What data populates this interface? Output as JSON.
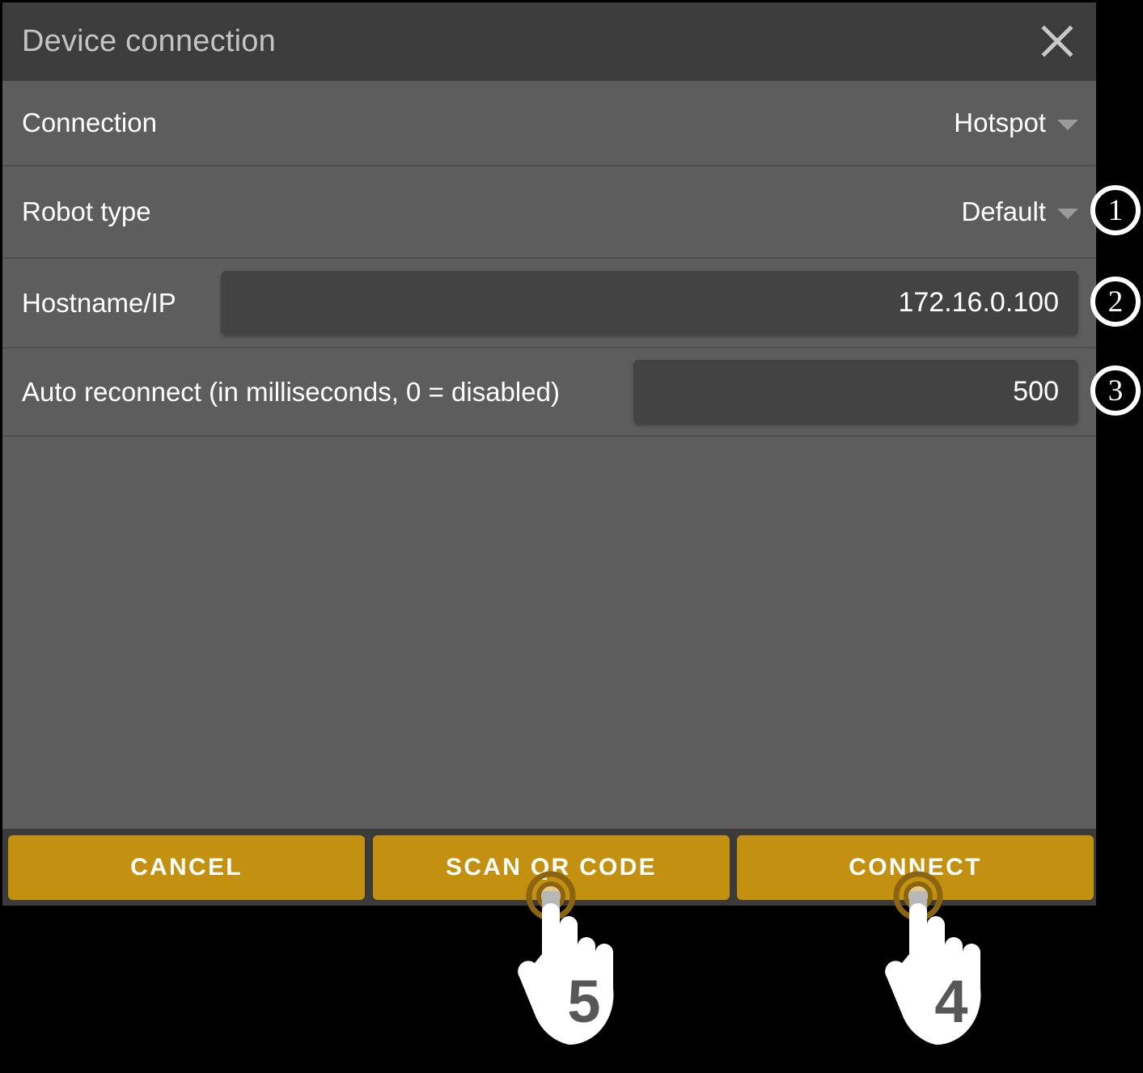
{
  "dialog": {
    "title": "Device connection",
    "close_icon": "close-icon"
  },
  "rows": {
    "connection": {
      "label": "Connection",
      "value": "Hotspot",
      "control": "dropdown"
    },
    "robot_type": {
      "label": "Robot type",
      "value": "Default",
      "control": "dropdown"
    },
    "hostname": {
      "label": "Hostname/IP",
      "value": "172.16.0.100",
      "control": "text-field"
    },
    "auto_reconnect": {
      "label": "Auto reconnect (in milliseconds, 0 = disabled)",
      "value": "500",
      "control": "text-field"
    }
  },
  "footer": {
    "cancel_label": "CANCEL",
    "scan_qr_label": "SCAN QR CODE",
    "connect_label": "CONNECT"
  },
  "annotations": {
    "badges": [
      {
        "number": "1",
        "target": "robot-type-dropdown"
      },
      {
        "number": "2",
        "target": "hostname-field"
      },
      {
        "number": "3",
        "target": "auto-reconnect-field"
      }
    ],
    "hands": [
      {
        "number": "5",
        "target": "scan-qr-code-button"
      },
      {
        "number": "4",
        "target": "connect-button"
      }
    ]
  },
  "colors": {
    "accent": "#c4900f",
    "dialog_background": "#5d5d5d",
    "titlebar_background": "#3c3c3c",
    "field_background": "#434343",
    "page_background": "#000000",
    "text": "#ffffff",
    "title_text": "#c4c4c4",
    "hand_fill": "#ffffff",
    "hand_number": "#575757"
  }
}
